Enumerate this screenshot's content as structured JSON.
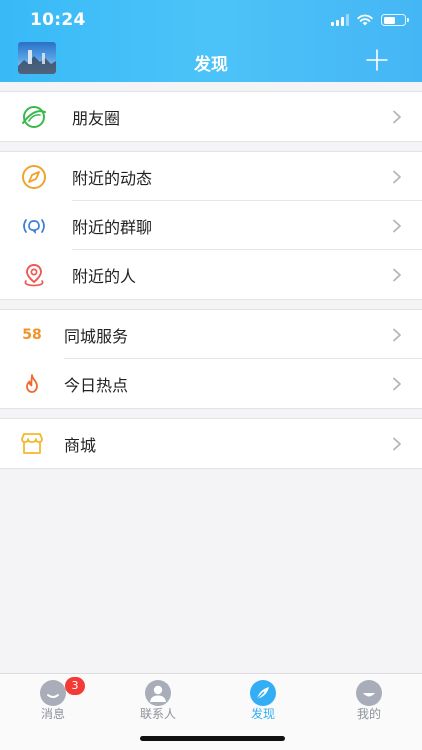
{
  "status": {
    "time": "10:24"
  },
  "header": {
    "title": "发现"
  },
  "groups": [
    {
      "items": [
        {
          "label": "朋友圈",
          "icon": "moments-icon"
        }
      ]
    },
    {
      "items": [
        {
          "label": "附近的动态",
          "icon": "compass-icon"
        },
        {
          "label": "附近的群聊",
          "icon": "broadcast-icon"
        },
        {
          "label": "附近的人",
          "icon": "location-pin-icon"
        }
      ]
    },
    {
      "items": [
        {
          "label": "同城服务",
          "icon": "58-icon",
          "icon_text": "58"
        },
        {
          "label": "今日热点",
          "icon": "flame-icon"
        }
      ]
    },
    {
      "items": [
        {
          "label": "商城",
          "icon": "shop-icon"
        }
      ]
    }
  ],
  "tabbar": {
    "items": [
      {
        "label": "消息",
        "icon": "message-icon",
        "badge": "3"
      },
      {
        "label": "联系人",
        "icon": "contacts-icon"
      },
      {
        "label": "发现",
        "icon": "discover-icon",
        "active": true
      },
      {
        "label": "我的",
        "icon": "profile-icon"
      }
    ]
  },
  "colors": {
    "header": "#45bdf8",
    "accent": "#33aef4",
    "badge": "#f33a36",
    "tab_inactive": "#a9adb9"
  }
}
